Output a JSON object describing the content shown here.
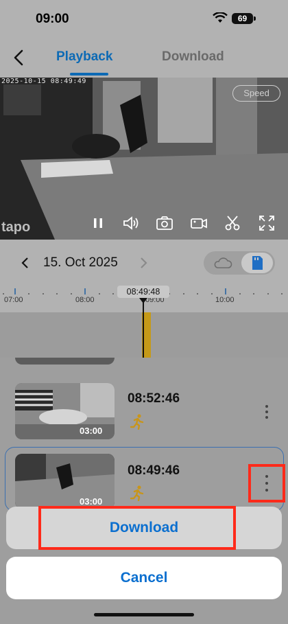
{
  "status_bar": {
    "time": "09:00",
    "battery": "69"
  },
  "nav": {
    "tabs": [
      {
        "label": "Playback",
        "active": true
      },
      {
        "label": "Download",
        "active": false
      }
    ]
  },
  "player": {
    "timestamp": "2025-10-15 08:49:49",
    "speed_label": "Speed",
    "watermark": "tapo",
    "controls": [
      "pause-icon",
      "volume-icon",
      "camera-icon",
      "record-icon",
      "scissors-icon",
      "fullscreen-icon"
    ]
  },
  "date_bar": {
    "date": "15. Oct 2025",
    "storage_options": [
      "cloud-icon",
      "sd-card-icon"
    ],
    "selected_storage": "sd-card"
  },
  "timeline": {
    "ticks": [
      "07:00",
      "08:00",
      "09:00",
      "10:00"
    ],
    "cursor_time": "08:49:48"
  },
  "recordings": [
    {
      "time": "08:52:46",
      "duration": "03:00",
      "event_icon": "motion-person-icon"
    },
    {
      "time": "08:49:46",
      "duration": "03:00",
      "event_icon": "motion-person-icon",
      "selected": true
    }
  ],
  "action_sheet": {
    "download_label": "Download",
    "cancel_label": "Cancel"
  },
  "colors": {
    "accent": "#0c6ab5",
    "event": "#c59a18",
    "highlight": "#ff2a1a"
  }
}
